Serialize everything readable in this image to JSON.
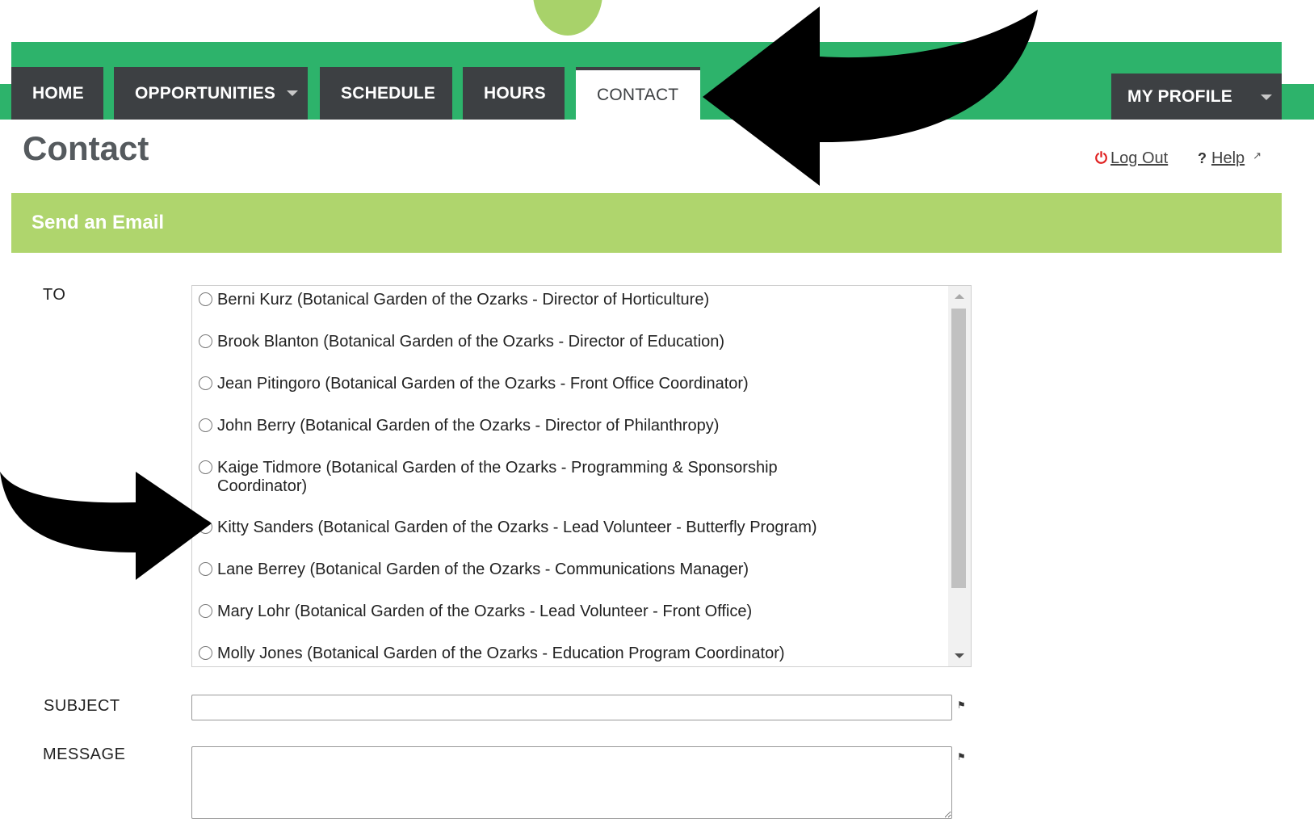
{
  "nav": {
    "tabs": [
      {
        "label": "HOME"
      },
      {
        "label": "OPPORTUNITIES"
      },
      {
        "label": "SCHEDULE"
      },
      {
        "label": "HOURS"
      },
      {
        "label": "CONTACT"
      }
    ],
    "active_tab": "CONTACT",
    "profile_label": "MY PROFILE"
  },
  "page": {
    "title": "Contact"
  },
  "header_links": {
    "logout": "Log Out",
    "help_mark": "?",
    "help": "Help"
  },
  "email_form": {
    "section_title": "Send an Email",
    "to_label": "TO",
    "subject_label": "SUBJECT",
    "message_label": "MESSAGE",
    "subject_value": "",
    "message_value": "",
    "recipients": [
      {
        "text": "Berni Kurz (Botanical Garden of the Ozarks - Director of Horticulture)"
      },
      {
        "text": "Brook Blanton (Botanical Garden of the Ozarks - Director of Education)"
      },
      {
        "text": "Jean Pitingoro (Botanical Garden of the Ozarks - Front Office Coordinator)"
      },
      {
        "text": "John Berry (Botanical Garden of the Ozarks - Director of Philanthropy)"
      },
      {
        "text": "Kaige Tidmore (Botanical Garden of the Ozarks - Programming & Sponsorship Coordinator)"
      },
      {
        "text": "Kitty Sanders (Botanical Garden of the Ozarks - Lead Volunteer - Butterfly Program)"
      },
      {
        "text": "Lane Berrey (Botanical Garden of the Ozarks - Communications Manager)"
      },
      {
        "text": "Mary Lohr (Botanical Garden of the Ozarks - Lead Volunteer - Front Office)"
      },
      {
        "text": "Molly Jones (Botanical Garden of the Ozarks - Education Program Coordinator)"
      }
    ]
  },
  "icons": {
    "logout": "power-icon",
    "help_external": "external-link-icon",
    "field_flag": "flag-icon"
  },
  "colors": {
    "brand_green": "#2db36b",
    "section_green": "#afd56d",
    "nav_dark": "#3d4043",
    "logout_red": "#e02020"
  }
}
